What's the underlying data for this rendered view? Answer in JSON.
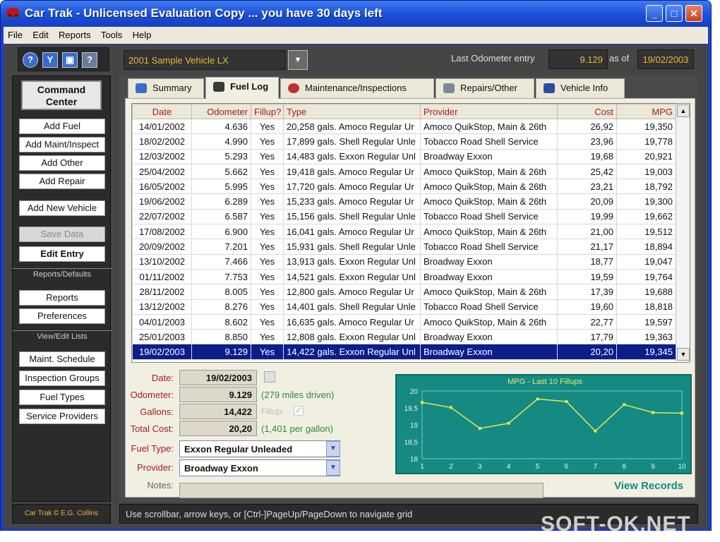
{
  "window": {
    "title": "Car Trak - Unlicensed Evaluation Copy ... you have 30 days left"
  },
  "menu": [
    "File",
    "Edit",
    "Reports",
    "Tools",
    "Help"
  ],
  "toolbar_icons": [
    "help-icon",
    "filter-icon",
    "screen-icon",
    "pointer-help-icon"
  ],
  "header": {
    "vehicle": "2001 Sample Vehicle LX",
    "last_odometer_label": "Last Odometer entry",
    "last_odometer_value": "9.129",
    "as_of_label": "as of",
    "as_of_value": "19/02/2003"
  },
  "sidebar": {
    "title_line1": "Command",
    "title_line2": "Center",
    "buttons": {
      "add_fuel": "Add Fuel",
      "add_maint": "Add Maint/Inspect",
      "add_other": "Add Other",
      "add_repair": "Add Repair",
      "add_vehicle": "Add New Vehicle",
      "save_data": "Save Data",
      "edit_entry": "Edit Entry",
      "reports": "Reports",
      "preferences": "Preferences",
      "maint_schedule": "Maint. Schedule",
      "inspection_groups": "Inspection Groups",
      "fuel_types": "Fuel Types",
      "service_providers": "Service Providers"
    },
    "section_reports": "Reports/Defaults",
    "section_lists": "View/Edit Lists",
    "credit": "Car Trak © E.G. Collins"
  },
  "tabs": [
    "Summary",
    "Fuel Log",
    "Maintenance/Inspections",
    "Repairs/Other",
    "Vehicle Info"
  ],
  "grid": {
    "columns": [
      "Date",
      "Odometer",
      "Fillup?",
      "Type",
      "Provider",
      "Cost",
      "MPG"
    ],
    "rows": [
      [
        "14/01/2002",
        "4.636",
        "Yes",
        "20,258 gals. Amoco Regular Ur",
        "Amoco QuikStop, Main & 26th",
        "26,92",
        "19,350"
      ],
      [
        "18/02/2002",
        "4.990",
        "Yes",
        "17,899 gals. Shell Regular Unle",
        "Tobacco Road Shell Service",
        "23,96",
        "19,778"
      ],
      [
        "12/03/2002",
        "5.293",
        "Yes",
        "14,483 gals. Exxon Regular Unl",
        "Broadway Exxon",
        "19,68",
        "20,921"
      ],
      [
        "25/04/2002",
        "5.662",
        "Yes",
        "19,418 gals. Amoco Regular Ur",
        "Amoco QuikStop, Main & 26th",
        "25,42",
        "19,003"
      ],
      [
        "16/05/2002",
        "5.995",
        "Yes",
        "17,720 gals. Amoco Regular Ur",
        "Amoco QuikStop, Main & 26th",
        "23,21",
        "18,792"
      ],
      [
        "19/06/2002",
        "6.289",
        "Yes",
        "15,233 gals. Amoco Regular Ur",
        "Amoco QuikStop, Main & 26th",
        "20,09",
        "19,300"
      ],
      [
        "22/07/2002",
        "6.587",
        "Yes",
        "15,156 gals. Shell Regular Unle",
        "Tobacco Road Shell Service",
        "19,99",
        "19,662"
      ],
      [
        "17/08/2002",
        "6.900",
        "Yes",
        "16,041 gals. Amoco Regular Ur",
        "Amoco QuikStop, Main & 26th",
        "21,00",
        "19,512"
      ],
      [
        "20/09/2002",
        "7.201",
        "Yes",
        "15,931 gals. Shell Regular Unle",
        "Tobacco Road Shell Service",
        "21,17",
        "18,894"
      ],
      [
        "13/10/2002",
        "7.466",
        "Yes",
        "13,913 gals. Exxon Regular Unl",
        "Broadway Exxon",
        "18,77",
        "19,047"
      ],
      [
        "01/11/2002",
        "7.753",
        "Yes",
        "14,521 gals. Exxon Regular Unl",
        "Broadway Exxon",
        "19,59",
        "19,764"
      ],
      [
        "28/11/2002",
        "8.005",
        "Yes",
        "12,800 gals. Amoco Regular Ur",
        "Amoco QuikStop, Main & 26th",
        "17,39",
        "19,688"
      ],
      [
        "13/12/2002",
        "8.276",
        "Yes",
        "14,401 gals. Shell Regular Unle",
        "Tobacco Road Shell Service",
        "19,60",
        "18,818"
      ],
      [
        "04/01/2003",
        "8.602",
        "Yes",
        "16,635 gals. Amoco Regular Ur",
        "Amoco QuikStop, Main & 26th",
        "22,77",
        "19,597"
      ],
      [
        "25/01/2003",
        "8.850",
        "Yes",
        "12,808 gals. Exxon Regular Unl",
        "Broadway Exxon",
        "17,79",
        "19,363"
      ],
      [
        "19/02/2003",
        "9.129",
        "Yes",
        "14,422 gals. Exxon Regular Unl",
        "Broadway Exxon",
        "20,20",
        "19,345"
      ]
    ],
    "selected_index": 15
  },
  "detail": {
    "date_label": "Date:",
    "date_value": "19/02/2003",
    "odometer_label": "Odometer:",
    "odometer_value": "9.129",
    "odometer_note": "(279 miles driven)",
    "gallons_label": "Gallons:",
    "gallons_value": "14,422",
    "fillup_label": "Fillup:",
    "total_cost_label": "Total Cost:",
    "total_cost_value": "20,20",
    "total_cost_note": "(1,401 per gallon)",
    "fuel_type_label": "Fuel Type:",
    "fuel_type_value": "Exxon Regular Unleaded",
    "provider_label": "Provider:",
    "provider_value": "Broadway Exxon",
    "notes_label": "Notes:",
    "view_records": "View Records"
  },
  "chart_data": {
    "type": "line",
    "title": "MPG - Last 10 Fillups",
    "x": [
      1,
      2,
      3,
      4,
      5,
      6,
      7,
      8,
      9,
      10
    ],
    "values": [
      19.662,
      19.512,
      18.894,
      19.047,
      19.764,
      19.688,
      18.818,
      19.597,
      19.363,
      19.345
    ],
    "y_ticks": [
      "20",
      "19,5",
      "19",
      "18,5",
      "18"
    ],
    "ylim": [
      18,
      20
    ],
    "grid": false,
    "line_color": "#e8e850",
    "bg_color": "#148a82"
  },
  "status": "Use scrollbar, arrow keys, or [Ctrl-]PageUp/PageDown to navigate grid",
  "watermark": "SOFT-OK.NET"
}
